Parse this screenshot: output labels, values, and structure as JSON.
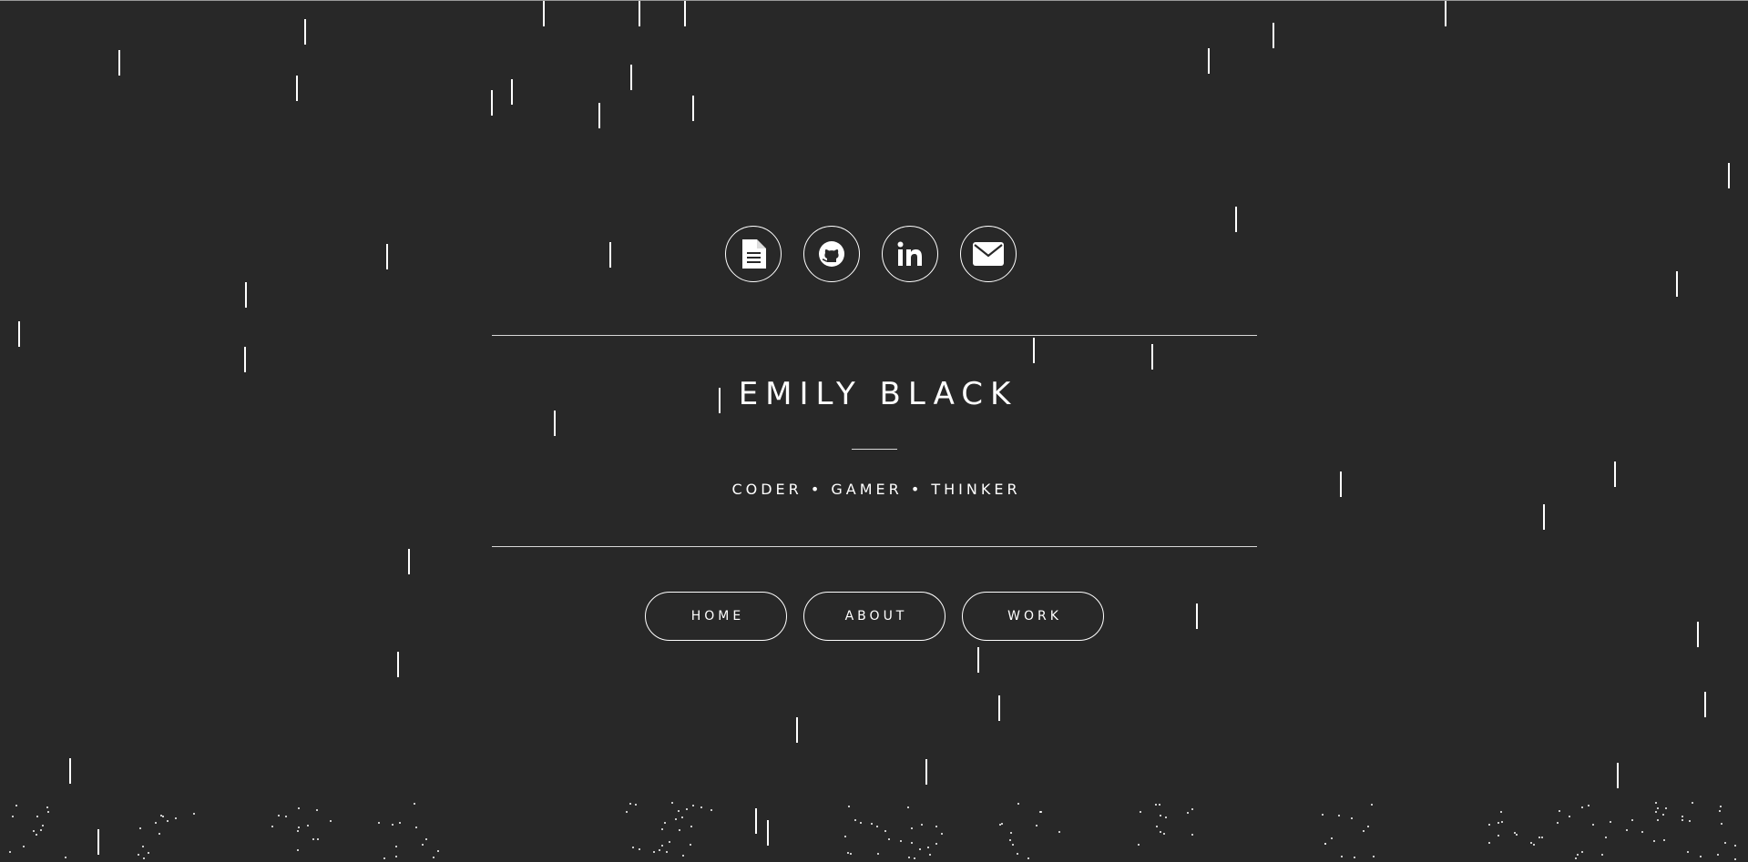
{
  "colors": {
    "background": "#282828",
    "foreground": "#ffffff",
    "rule": "#d8d8d8"
  },
  "social_links": [
    {
      "id": "resume",
      "icon": "document-icon"
    },
    {
      "id": "github",
      "icon": "github-icon"
    },
    {
      "id": "linkedin",
      "icon": "linkedin-icon"
    },
    {
      "id": "email",
      "icon": "envelope-icon"
    }
  ],
  "profile": {
    "name": "EMILY BLACK",
    "tagline": "CODER • GAMER • THINKER"
  },
  "nav": {
    "home_label": "HOME",
    "about_label": "ABOUT",
    "work_label": "WORK"
  },
  "background_effect": "falling-rain"
}
